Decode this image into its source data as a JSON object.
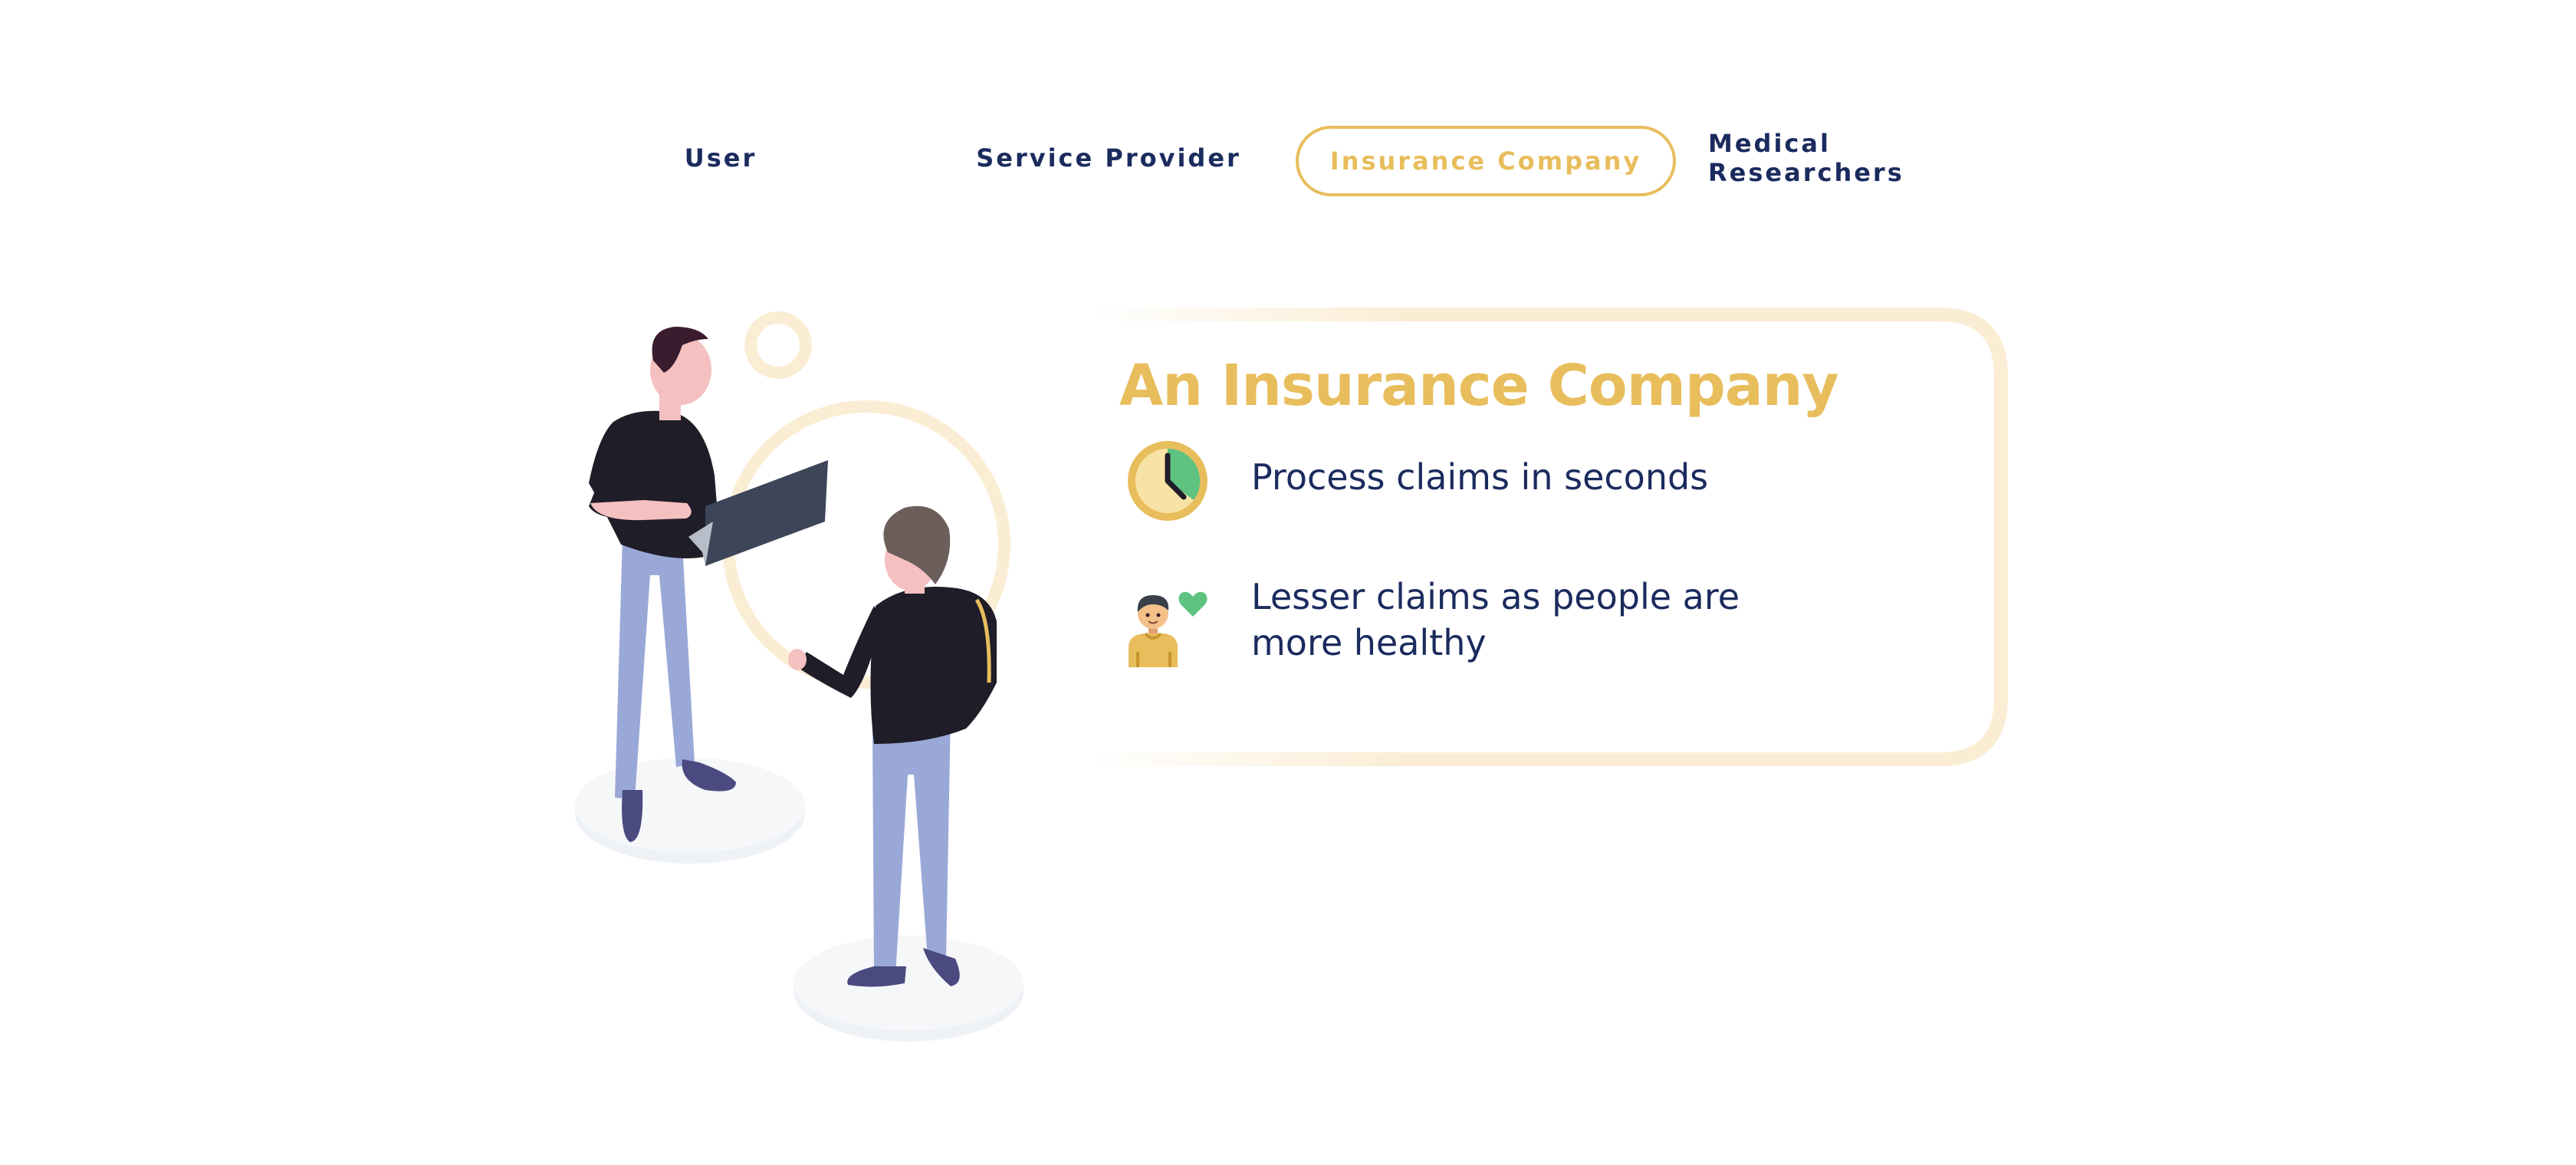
{
  "tabs": [
    {
      "id": "user",
      "label": "User",
      "active": false
    },
    {
      "id": "service-provider",
      "label": "Service Provider",
      "active": false
    },
    {
      "id": "insurance-company",
      "label": "Insurance Company",
      "active": true
    },
    {
      "id": "medical-researchers",
      "label": "Medical Researchers",
      "active": false
    }
  ],
  "card": {
    "title": "An Insurance Company",
    "benefits": [
      {
        "icon": "clock-icon",
        "text": "Process claims in seconds"
      },
      {
        "icon": "healthy-person-heart-icon",
        "text": "Lesser claims as people are more healthy"
      }
    ]
  },
  "colors": {
    "accent": "#e8bd5c",
    "accent_light": "#fbedd4",
    "text_dark": "#1b2b5e",
    "heart_green": "#5ec281"
  },
  "illustration": {
    "icon": "two-people-with-laptop-illustration"
  }
}
